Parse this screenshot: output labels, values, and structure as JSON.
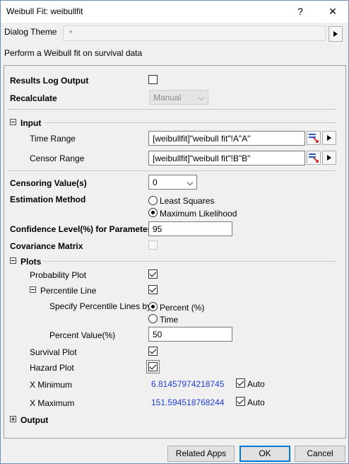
{
  "window": {
    "title": "Weibull Fit: weibullfit",
    "help_label": "?",
    "close_label": "✕"
  },
  "theme": {
    "label": "Dialog Theme",
    "value": "*"
  },
  "description": "Perform a Weibull fit on survival data",
  "results_log": {
    "label": "Results Log Output",
    "checked": false
  },
  "recalculate": {
    "label": "Recalculate",
    "value": "Manual"
  },
  "input": {
    "label": "Input",
    "time_range": {
      "label": "Time Range",
      "value": "[weibullfit]\"weibull fit\"!A\"A\""
    },
    "censor_range": {
      "label": "Censor Range",
      "value": "[weibullfit]\"weibull fit\"!B\"B\""
    }
  },
  "censoring_value": {
    "label": "Censoring Value(s)",
    "value": "0"
  },
  "estimation": {
    "label": "Estimation Method",
    "options": [
      "Least Squares",
      "Maximum Likelihood"
    ],
    "selected": "Maximum Likelihood"
  },
  "confidence": {
    "label": "Confidence Level(%) for Parameters",
    "value": "95"
  },
  "covariance": {
    "label": "Covariance Matrix",
    "checked": false
  },
  "plots": {
    "label": "Plots",
    "probability_plot": {
      "label": "Probability Plot",
      "checked": true
    },
    "percentile_line": {
      "label": "Percentile Line",
      "checked": true
    },
    "specify_by": {
      "label": "Specify Percentile Lines by",
      "options": [
        "Percent (%)",
        "Time"
      ],
      "selected": "Percent (%)"
    },
    "percent_value": {
      "label": "Percent Value(%)",
      "value": "50"
    },
    "survival_plot": {
      "label": "Survival Plot",
      "checked": true
    },
    "hazard_plot": {
      "label": "Hazard Plot",
      "checked": true
    },
    "x_minimum": {
      "label": "X Minimum",
      "value": "6.81457974218745",
      "auto_label": "Auto",
      "auto": true
    },
    "x_maximum": {
      "label": "X Maximum",
      "value": "151.594518768244",
      "auto_label": "Auto",
      "auto": true
    }
  },
  "output": {
    "label": "Output"
  },
  "buttons": {
    "related_apps": "Related Apps",
    "ok": "OK",
    "cancel": "Cancel"
  }
}
